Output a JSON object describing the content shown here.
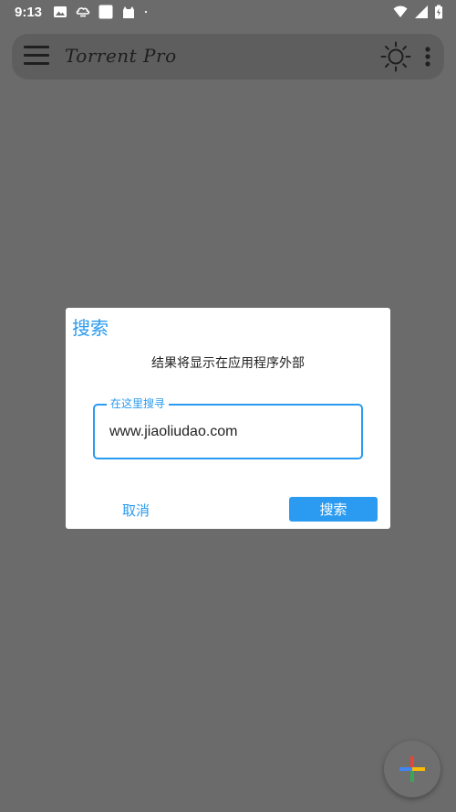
{
  "status_bar": {
    "time": "9:13",
    "left_icons": [
      "image-icon",
      "cloud-icon",
      "square-icon",
      "android-icon",
      "dot-icon"
    ],
    "right_icons": [
      "wifi-icon",
      "signal-icon",
      "battery-icon"
    ]
  },
  "toolbar": {
    "title": "Torrent Pro",
    "icons": [
      "menu-icon",
      "brightness-icon",
      "more-vert-icon"
    ]
  },
  "dialog": {
    "title": "搜索",
    "message": "结果将显示在应用程序外部",
    "field_label": "在这里搜寻",
    "field_value": "www.jiaoliudao.com",
    "cancel_label": "取消",
    "search_label": "搜索"
  },
  "fab": {
    "icon": "add-icon"
  },
  "colors": {
    "accent": "#2a9bf0",
    "scrim_background": "#6b6b6b",
    "toolbar_background": "#5e5e5e",
    "dialog_background": "#ffffff"
  }
}
